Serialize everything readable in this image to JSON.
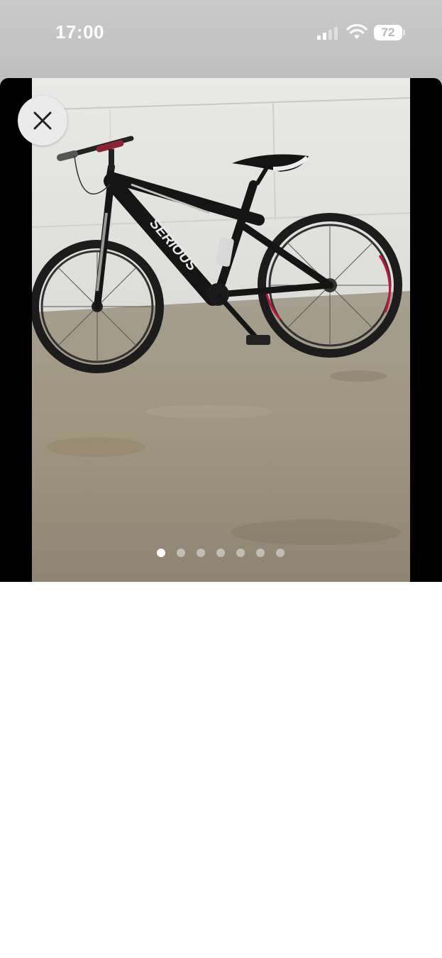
{
  "status_bar": {
    "time": "17:00",
    "battery_level": "72",
    "signal_bars": 2,
    "icons": [
      "signal-icon",
      "wifi-icon",
      "battery-icon"
    ]
  },
  "viewer": {
    "photo_subject": "black full-suspension mountain bike",
    "frame_brand_text": "SERIOUS",
    "page_count": 7,
    "current_page": 1,
    "close_icon": "close-icon"
  },
  "colors": {
    "status_backdrop": "#c4c4c4",
    "viewer_background": "#000000",
    "close_button": "#ebebeb",
    "dot_active": "#ffffff"
  }
}
